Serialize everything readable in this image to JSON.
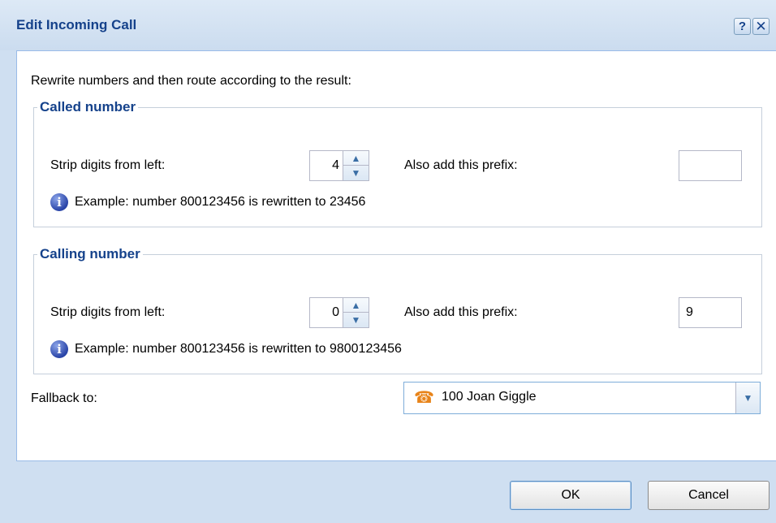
{
  "window": {
    "title": "Edit Incoming Call",
    "help_glyph": "?",
    "close_glyph": "✕"
  },
  "intro_text": "Rewrite numbers and then route according to the result:",
  "called_number": {
    "legend": "Called number",
    "strip_label": "Strip digits from left:",
    "strip_value": "4",
    "prefix_label": "Also add this prefix:",
    "prefix_value": "",
    "example_text": "Example: number 800123456 is rewritten to 23456"
  },
  "calling_number": {
    "legend": "Calling number",
    "strip_label": "Strip digits from left:",
    "strip_value": "0",
    "prefix_label": "Also add this prefix:",
    "prefix_value": "9",
    "example_text": "Example: number 800123456 is rewritten to 9800123456"
  },
  "fallback": {
    "label": "Fallback to:",
    "selected_value": "100 Joan Giggle",
    "icon": "phone-icon"
  },
  "buttons": {
    "ok_label": "OK",
    "cancel_label": "Cancel"
  },
  "colors": {
    "title_text": "#15428b",
    "frame_bg": "#cfdff1",
    "content_bg": "#ffffff",
    "info_icon": "#2a45a8",
    "phone_icon": "#e8841a"
  }
}
